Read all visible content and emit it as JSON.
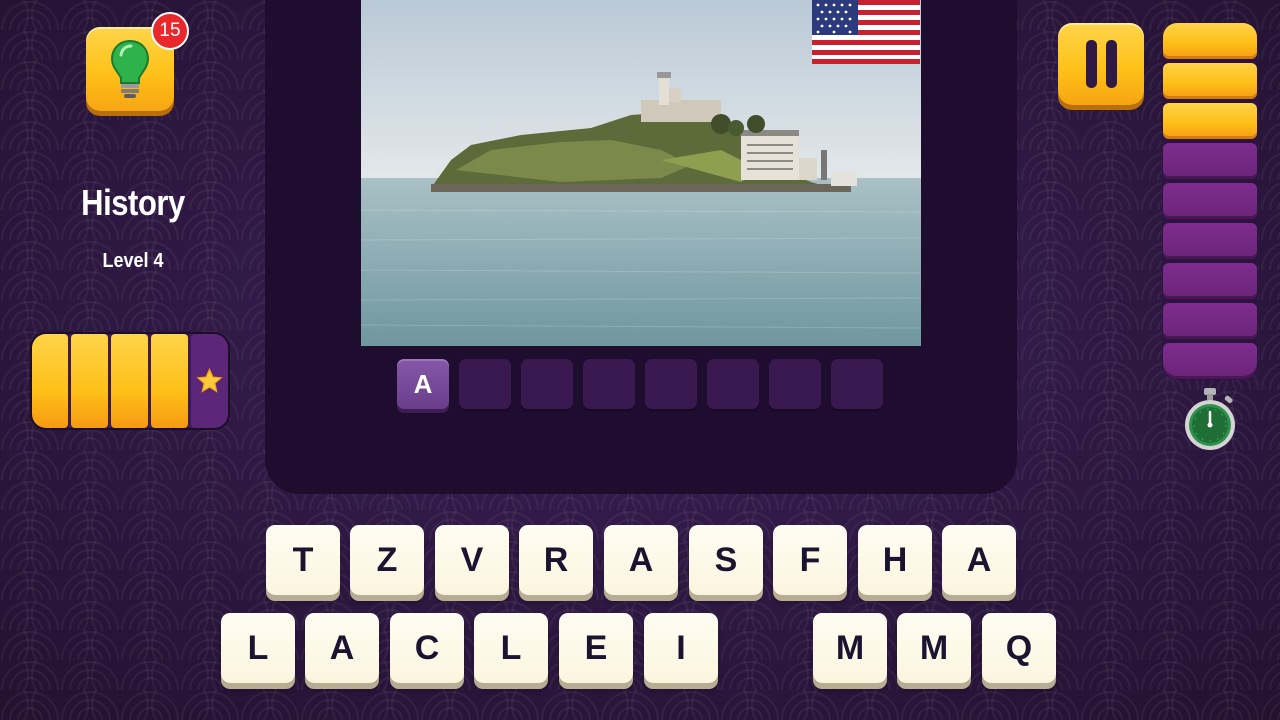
{
  "hint": {
    "icon": "lightbulb-icon",
    "count": "15"
  },
  "category": "History",
  "level": "Level 4",
  "progress": {
    "filled_segments": 4,
    "total_segments": 5,
    "reward_icon": "star-icon"
  },
  "puzzle": {
    "photo": "island-lighthouse-photo",
    "flag": "us-flag-icon",
    "answer_slots": [
      "A",
      "",
      "",
      "",
      "",
      "",
      "",
      ""
    ]
  },
  "pause": {
    "icon": "pause-icon"
  },
  "timer": {
    "filled_segments": 3,
    "total_segments": 9,
    "icon": "stopwatch-icon"
  },
  "keyboard": {
    "row1": [
      "T",
      "Z",
      "V",
      "R",
      "A",
      "S",
      "F",
      "H",
      "A"
    ],
    "row2": [
      "L",
      "A",
      "C",
      "L",
      "E",
      "I",
      "",
      "M",
      "M",
      "Q"
    ]
  },
  "colors": {
    "background": "#2a1740",
    "panel": "#1f0d30",
    "accent_yellow": "#ffc21a",
    "badge_red": "#e8282b",
    "key_face": "#fbf5df"
  }
}
